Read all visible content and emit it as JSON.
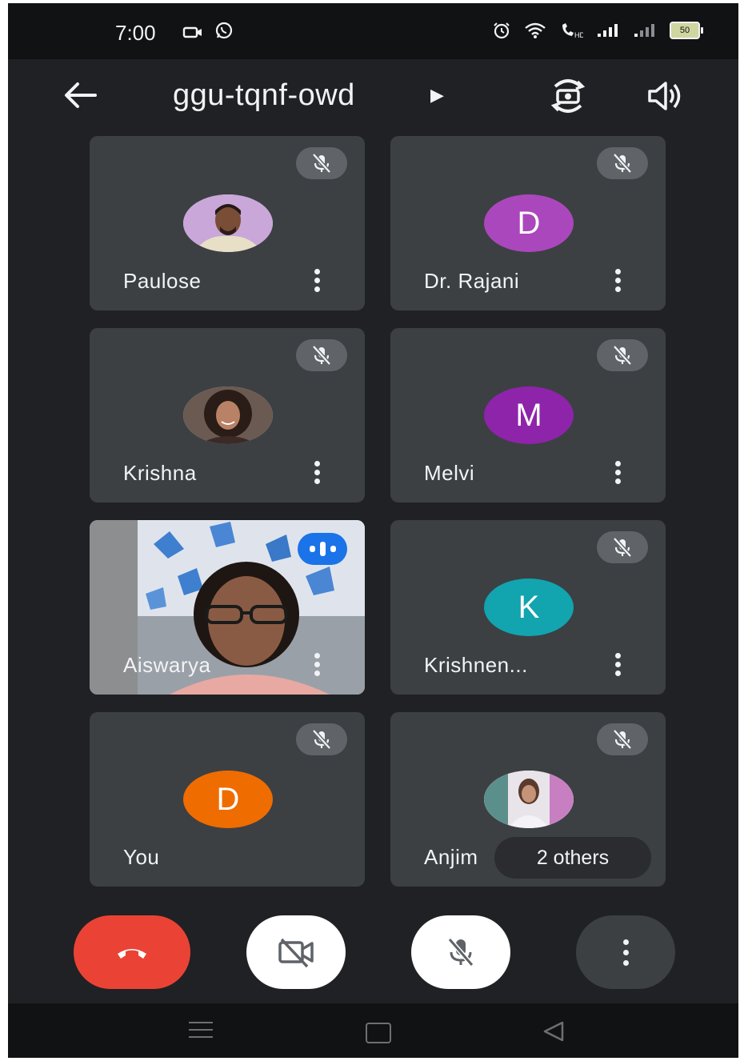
{
  "status_bar": {
    "time": "7:00",
    "left_icons": [
      "camera-icon",
      "whatsapp-icon"
    ],
    "right_icons": [
      "alarm-icon",
      "wifi-icon",
      "vowifi-call-icon",
      "signal-icon",
      "signal-icon-2",
      "battery-icon"
    ],
    "battery": "50"
  },
  "header": {
    "meeting_code": "ggu-tqnf-owd",
    "back_icon": "arrow-left-icon",
    "switch_camera_icon": "switch-camera-icon",
    "audio_icon": "speaker-icon"
  },
  "participants": [
    {
      "name": "Paulose",
      "avatar_type": "photo",
      "muted": true
    },
    {
      "name": "Dr. Rajani",
      "avatar_letter": "D",
      "avatar_color": "#ab47bc",
      "muted": true
    },
    {
      "name": "Krishna",
      "avatar_type": "photo",
      "muted": true
    },
    {
      "name": "Melvi",
      "avatar_letter": "M",
      "avatar_color": "#8e24aa",
      "muted": true
    },
    {
      "name": "Aiswarya",
      "avatar_type": "video",
      "speaking": true
    },
    {
      "name": "Krishnen...",
      "avatar_letter": "K",
      "avatar_color": "#12a4af",
      "muted": true
    },
    {
      "name": "You",
      "avatar_letter": "D",
      "avatar_color": "#ef6c00",
      "muted": true
    },
    {
      "name": "Anjim",
      "avatar_type": "photo",
      "muted": true,
      "overlay": "2 others"
    }
  ],
  "controls": {
    "end_call": "end-call-icon",
    "camera": "camera-off-icon",
    "mic": "mic-off-icon",
    "more": "more-vert-icon"
  },
  "colors": {
    "background": "#202124",
    "tile": "#3c4043",
    "end_call": "#ea4335",
    "speaking": "#1a73e8"
  }
}
